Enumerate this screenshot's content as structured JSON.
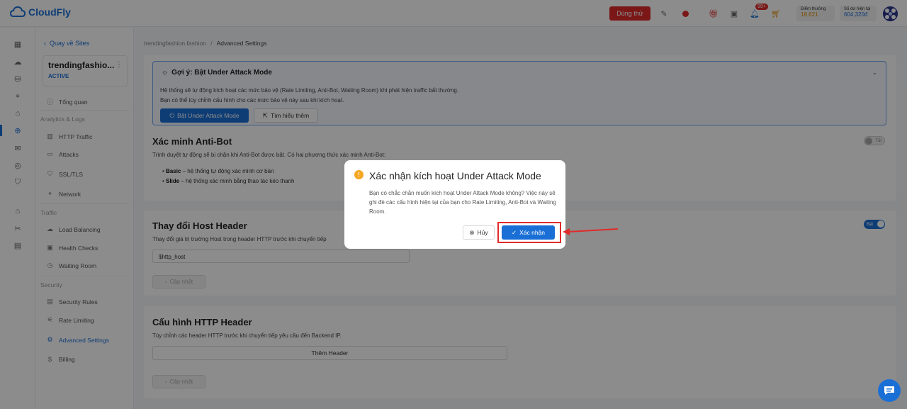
{
  "header": {
    "brand": "CloudFly",
    "trial_label": "Dùng thử",
    "notif_count": "99+",
    "points_label": "Điểm thưởng",
    "points_value": "18,621",
    "balance_label": "Số dư hiện tại",
    "balance_value": "604,320đ"
  },
  "sidebar": {
    "back_label": "Quay về Sites",
    "site_name": "trendingfashio...",
    "site_status": "ACTIVE",
    "overview": "Tổng quan",
    "section_analytics": "Analytics & Logs",
    "http_traffic": "HTTP Traffic",
    "attacks": "Attacks",
    "ssl": "SSL/TLS",
    "network": "Network",
    "section_traffic": "Traffic",
    "load_balancing": "Load Balancing",
    "health_checks": "Health Checks",
    "waiting_room": "Waiting Room",
    "section_security": "Security",
    "security_rules": "Security Rules",
    "rate_limiting": "Rate Limiting",
    "advanced_settings": "Advanced Settings",
    "billing": "Billing"
  },
  "breadcrumb": {
    "site": "trendingfashion.fashion",
    "sep": "/",
    "current": "Advanced Settings"
  },
  "hint": {
    "title": "Gợi ý: Bật Under Attack Mode",
    "line1": "Hệ thống sẽ tự động kích hoạt các mức bảo vệ (Rate Limiting, Anti-Bot, Waiting Room) khi phát hiện traffic bất thường.",
    "line2": "Bạn có thể tùy chỉnh cấu hình cho các mức bảo vệ này sau khi kích hoạt.",
    "enable_btn": "Bật Under Attack Mode",
    "learn_btn": "Tìm hiểu thêm"
  },
  "antibot": {
    "title": "Xác minh Anti-Bot",
    "desc": "Trình duyệt tự động sẽ bị chặn khi Anti-Bot được bật. Có hai phương thức xác minh Anti-Bot:",
    "basic_name": "Basic",
    "basic_desc": " – hệ thống tự động xác minh cơ bản",
    "slide_name": "Slide",
    "slide_desc": " – hệ thống xác minh bằng thao tác kéo thanh",
    "toggle_label": "Tắt"
  },
  "host_header": {
    "title": "Thay đổi Host Header",
    "desc": "Thay đổi giá trị trường Host trong header HTTP trước khi chuyển tiếp",
    "value": "$http_host",
    "update_btn": "Cập nhật",
    "toggle_label": "Bật"
  },
  "http_header": {
    "title": "Cấu hình HTTP Header",
    "desc": "Tùy chỉnh các header HTTP trước khi chuyển tiếp yêu cầu đến Backend IP.",
    "add_btn": "Thêm Header",
    "update_btn": "Cập nhật"
  },
  "modal": {
    "title": "Xác nhận kích hoạt Under Attack Mode",
    "body": "Bạn có chắc chắn muốn kích hoạt Under Attack Mode không? Việc này sẽ ghi đè các cấu hình hiện tại của bạn cho Rate Limiting, Anti-Bot và Waiting Room.",
    "cancel": "Hủy",
    "confirm": "Xác nhận"
  },
  "colors": {
    "accent": "#1a6fd6",
    "danger": "#e02b2b",
    "warning": "#f5a623"
  }
}
